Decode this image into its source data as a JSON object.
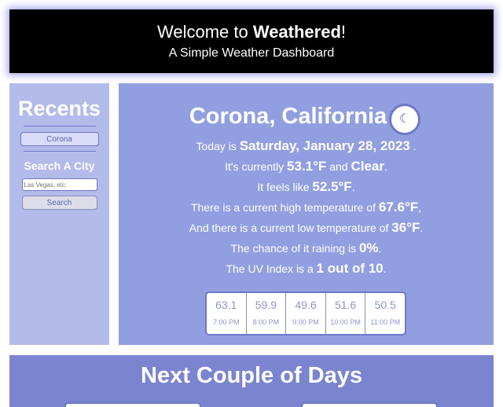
{
  "header": {
    "title_prefix": "Welcome to ",
    "title_brand": "Weathered",
    "title_suffix": "!",
    "subtitle": "A Simple Weather Dashboard"
  },
  "sidebar": {
    "recents_title": "Recents",
    "recent_cities": [
      "Corona"
    ],
    "search_title": "Search A City",
    "search_placeholder": "Las Vegas, etc.",
    "search_button": "Search"
  },
  "main": {
    "city": "Corona, California",
    "theme_icon": "moon-icon",
    "today_prefix": "Today is ",
    "date": "Saturday, January 28, 2023",
    "today_suffix": " .",
    "currently_prefix": "It's currently ",
    "temp": "53.1°F",
    "currently_mid": " and ",
    "condition": "Clear",
    "currently_suffix": ".",
    "feels_prefix": "It feels like ",
    "feels": "52.5°F",
    "feels_suffix": ".",
    "high_prefix": "There is a current high temperature of ",
    "high": "67.6°F",
    "high_suffix": ",",
    "low_prefix": "And there is a current low temperature of ",
    "low": "36°F",
    "low_suffix": ".",
    "rain_prefix": "The chance of it raining is ",
    "rain": "0%",
    "rain_suffix": ".",
    "uv_prefix": "The UV Index is a ",
    "uv": "1 out of 10",
    "uv_suffix": ".",
    "hourly": [
      {
        "temp": "63.1",
        "time": "7:00 PM"
      },
      {
        "temp": "59.9",
        "time": "8:00 PM"
      },
      {
        "temp": "49.6",
        "time": "9:00 PM"
      },
      {
        "temp": "51.6",
        "time": "10:00 PM"
      },
      {
        "temp": "50.5",
        "time": "11:00 PM"
      }
    ]
  },
  "next": {
    "title": "Next Couple of Days"
  },
  "colors": {
    "header_bg": "#000000",
    "sidebar_bg": "#b3bbeb",
    "main_bg": "#919fe0",
    "next_bg": "#7a84cf",
    "accent": "#6f78c8"
  }
}
